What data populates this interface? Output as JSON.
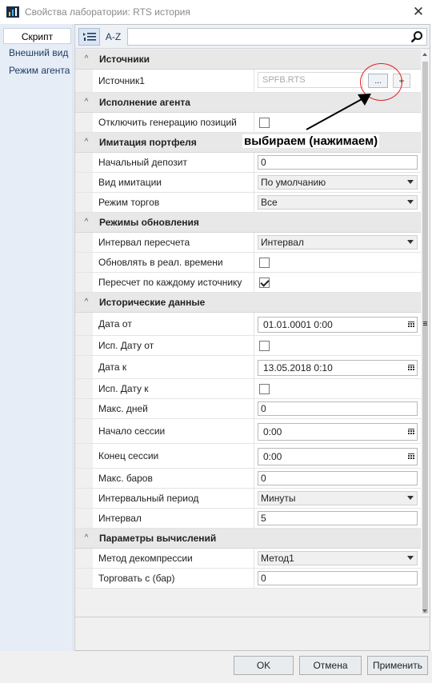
{
  "window": {
    "title": "Свойства лаборатории: RTS история"
  },
  "nav": {
    "items": [
      "Скрипт",
      "Внешний вид",
      "Режим агента"
    ]
  },
  "toolbar": {
    "sort_label": "A-Z",
    "search_value": ""
  },
  "categories": {
    "sources": "Источники",
    "agent": "Исполнение агента",
    "portfolio": "Имитация портфеля",
    "update": "Режимы обновления",
    "history": "Исторические данные",
    "calc": "Параметры вычислений"
  },
  "props": {
    "source1": {
      "name": "Источник1",
      "value": "SPFB.RTS",
      "browse": "...",
      "add": "+"
    },
    "disable_positions": {
      "name": "Отключить генерацию позиций",
      "checked": false
    },
    "initial_deposit": {
      "name": "Начальный депозит",
      "value": "0"
    },
    "imitation_type": {
      "name": "Вид имитации",
      "value": "По умолчанию"
    },
    "trade_mode": {
      "name": "Режим торгов",
      "value": "Все"
    },
    "recalc_interval": {
      "name": "Интервал пересчета",
      "value": "Интервал"
    },
    "realtime_update": {
      "name": "Обновлять в реал. времени",
      "checked": false
    },
    "recalc_each_source": {
      "name": "Пересчет по каждому источнику",
      "checked": true
    },
    "date_from": {
      "name": "Дата от",
      "value": "01.01.0001 0:00"
    },
    "use_date_from": {
      "name": "Исп. Дату от",
      "checked": false
    },
    "date_to": {
      "name": "Дата к",
      "value": "13.05.2018 0:10"
    },
    "use_date_to": {
      "name": "Исп. Дату к",
      "checked": false
    },
    "max_days": {
      "name": "Макс. дней",
      "value": "0"
    },
    "session_start": {
      "name": "Начало сессии",
      "value": "0:00"
    },
    "session_end": {
      "name": "Конец сессии",
      "value": "0:00"
    },
    "max_bars": {
      "name": "Макс. баров",
      "value": "0"
    },
    "interval_period": {
      "name": "Интервальный период",
      "value": "Минуты"
    },
    "interval": {
      "name": "Интервал",
      "value": "5"
    },
    "decompression": {
      "name": "Метод декомпрессии",
      "value": "Метод1"
    },
    "trade_from_bar": {
      "name": "Торговать с (бар)",
      "value": "0"
    }
  },
  "annotation": {
    "text": "выбираем (нажимаем)",
    "color": "#e32020"
  },
  "buttons": {
    "ok": "OK",
    "cancel": "Отмена",
    "apply": "Применить"
  }
}
